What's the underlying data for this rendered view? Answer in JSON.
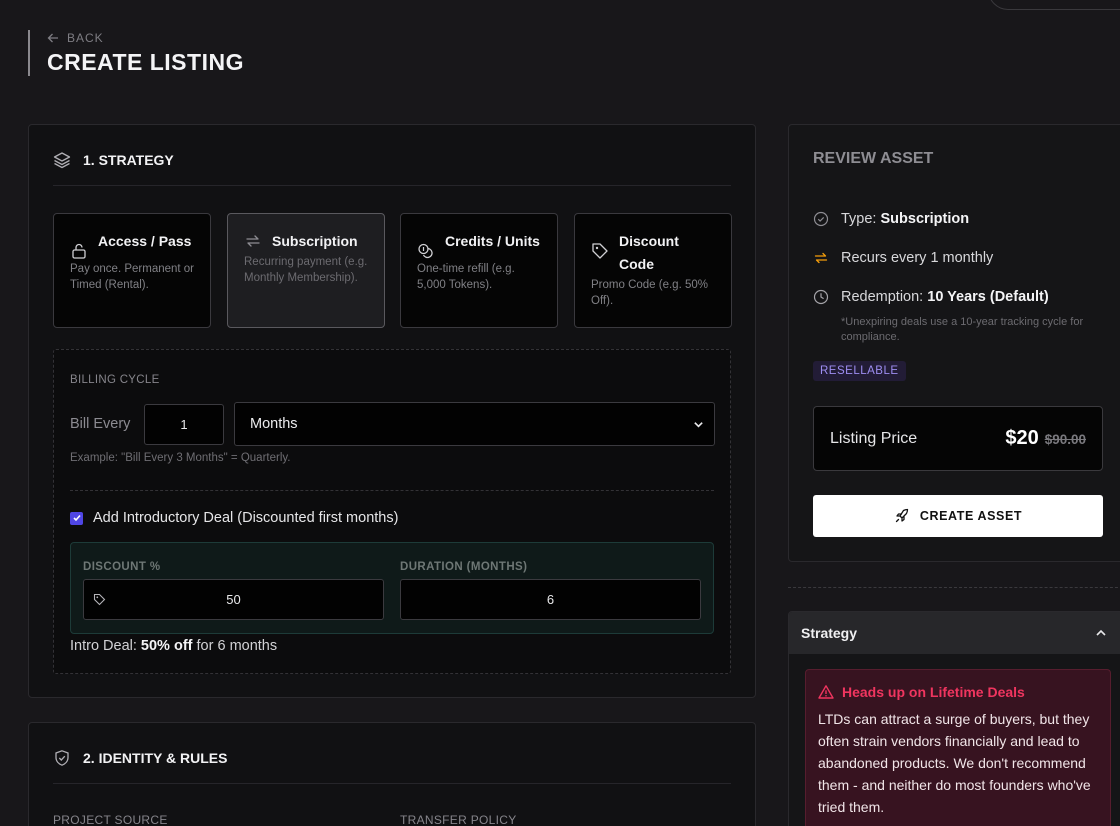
{
  "header": {
    "back_label": "BACK",
    "title": "CREATE LISTING"
  },
  "strategy": {
    "title": "1. STRATEGY",
    "tiles": [
      {
        "title": "Access / Pass",
        "desc": "Pay once. Permanent or Timed (Rental).",
        "icon": "lock-open-icon"
      },
      {
        "title": "Subscription",
        "desc": "Recurring payment (e.g. Monthly Membership).",
        "icon": "repeat-icon"
      },
      {
        "title": "Credits / Units",
        "desc": "One-time refill (e.g. 5,000 Tokens).",
        "icon": "coins-icon"
      },
      {
        "title": "Discount Code",
        "desc": "Promo Code (e.g. 50% Off).",
        "icon": "tag-icon"
      }
    ],
    "selected_tile": "Subscription",
    "billing": {
      "label": "BILLING CYCLE",
      "bill_every_label": "Bill Every",
      "interval_value": "1",
      "unit_value": "Months",
      "example": "Example: \"Bill Every 3 Months\" = Quarterly."
    },
    "intro_deal": {
      "checkbox_label": "Add Introductory Deal (Discounted first months)",
      "checked": true,
      "discount_label": "DISCOUNT %",
      "discount_value": "50",
      "duration_label": "DURATION (MONTHS)",
      "duration_value": "6",
      "summary_prefix": "Intro Deal: ",
      "summary_strong": "50% off",
      "summary_suffix": " for 6 months"
    }
  },
  "identity": {
    "title": "2. IDENTITY & RULES",
    "project_source_label": "PROJECT SOURCE",
    "transfer_policy_label": "TRANSFER POLICY"
  },
  "review": {
    "title": "REVIEW ASSET",
    "type_label": "Type: ",
    "type_value": "Subscription",
    "recurs_text": "Recurs every 1 monthly",
    "redemption_label": "Redemption: ",
    "redemption_value": "10 Years (Default)",
    "fineprint": "*Unexpiring deals use a 10-year tracking cycle for compliance.",
    "badge": "RESELLABLE",
    "price_label": "Listing Price",
    "price": "$20",
    "old_price": "$90.00",
    "create_button": "CREATE ASSET"
  },
  "accordion": {
    "title": "Strategy",
    "warning_title": "Heads up on Lifetime Deals",
    "warning_text": "LTDs can attract a surge of buyers, but they often strain vendors financially and lead to abandoned products. We don't recommend them - and neither do most founders who've tried them."
  },
  "colors": {
    "accent_checkbox": "#4f46e5",
    "recur_icon": "#f59e0b",
    "warning_text": "#f0355f",
    "badge_text": "#9e8ef2"
  }
}
